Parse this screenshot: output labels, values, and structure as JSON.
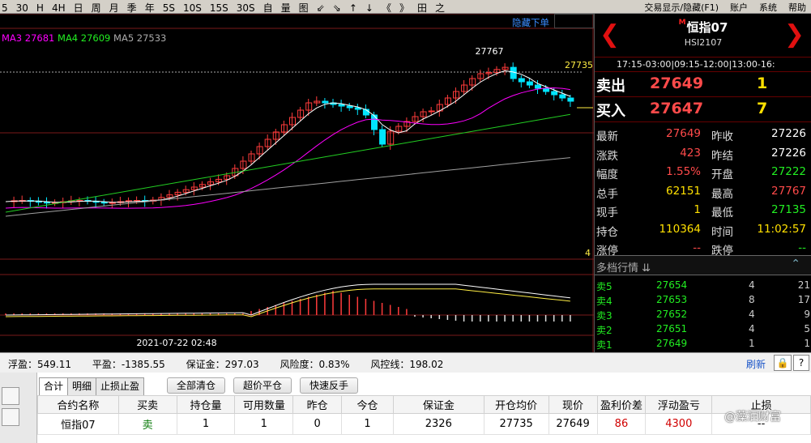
{
  "toolbar": {
    "items": [
      "5",
      "30",
      "H",
      "4H",
      "日",
      "周",
      "月",
      "季",
      "年",
      "5S",
      "10S",
      "15S",
      "30S",
      "自",
      "量",
      "图",
      "⇙",
      "⇘",
      "↑",
      "↓",
      "《",
      "》",
      "田",
      "之"
    ],
    "menu": [
      "交易显示/隐藏(F1)",
      "账户",
      "系统",
      "帮助"
    ]
  },
  "chart": {
    "ma_legend": {
      "ma3": "MA3 27681",
      "ma4": "MA4 27609",
      "ma5": "MA5 27533"
    },
    "hide_order_label": "隐藏下单",
    "high_label": "27767",
    "price_label": "27735",
    "lot_label": "4",
    "date_label": "2021-07-22 02:48",
    "colors": {
      "up": "#ff3b3b",
      "down": "#00e5ff",
      "ma3": "#ffffff",
      "ma4": "#ff00ff",
      "ma5_green": "#22cc22",
      "ma_gray": "#a0a0a0",
      "macd_white": "#ffffff",
      "macd_yellow": "#ffee44"
    }
  },
  "quote": {
    "name_prefix": "M",
    "name": "恒指07",
    "code": "HSI2107",
    "session": "17:15-03:00|09:15-12:00|13:00-16:",
    "ask": {
      "label": "卖出",
      "price": "27649",
      "volume": "1"
    },
    "bid": {
      "label": "买入",
      "price": "27647",
      "volume": "7"
    },
    "stats": [
      {
        "l1": "最新",
        "v1": "27649",
        "c1": "red",
        "l2": "昨收",
        "v2": "27226",
        "c2": "white"
      },
      {
        "l1": "涨跌",
        "v1": "423",
        "c1": "red",
        "l2": "昨结",
        "v2": "27226",
        "c2": "white"
      },
      {
        "l1": "幅度",
        "v1": "1.55%",
        "c1": "red",
        "l2": "开盘",
        "v2": "27222",
        "c2": "green"
      },
      {
        "l1": "总手",
        "v1": "62151",
        "c1": "yellow",
        "l2": "最高",
        "v2": "27767",
        "c2": "red"
      },
      {
        "l1": "现手",
        "v1": "1",
        "c1": "yellow",
        "l2": "最低",
        "v2": "27135",
        "c2": "green"
      },
      {
        "l1": "持仓",
        "v1": "110364",
        "c1": "yellow",
        "l2": "时间",
        "v2": "11:02:57",
        "c2": "yellow"
      },
      {
        "l1": "涨停",
        "v1": "--",
        "c1": "red",
        "l2": "跌停",
        "v2": "--",
        "c2": "green"
      }
    ],
    "depth_title": "多档行情",
    "depth": [
      {
        "label": "卖5",
        "price": "27654",
        "vol": "4",
        "total": "21"
      },
      {
        "label": "卖4",
        "price": "27653",
        "vol": "8",
        "total": "17"
      },
      {
        "label": "卖3",
        "price": "27652",
        "vol": "4",
        "total": "9"
      },
      {
        "label": "卖2",
        "price": "27651",
        "vol": "4",
        "total": "5"
      },
      {
        "label": "卖1",
        "price": "27649",
        "vol": "1",
        "total": "1"
      }
    ]
  },
  "account": {
    "float_pl": "浮盈：549.11",
    "close_pl": "平盈：-1385.55",
    "margin": "保证金：297.03",
    "risk": "风险度：0.83%",
    "risk_line": "风控线：198.02",
    "refresh": "刷新"
  },
  "trade": {
    "tabs": [
      "合计",
      "明细",
      "止损止盈"
    ],
    "actions": [
      "全部清仓",
      "超价平仓",
      "快速反手"
    ],
    "headers": [
      "合约名称",
      "买卖",
      "持仓量",
      "可用数量",
      "昨仓",
      "今仓",
      "保证金",
      "开仓均价",
      "现价",
      "盈利价差",
      "浮动盈亏",
      "止损"
    ],
    "rows": [
      [
        "恒指07",
        "卖",
        "1",
        "1",
        "0",
        "1",
        "2326",
        "27735",
        "27649",
        "86",
        "4300",
        "--"
      ]
    ],
    "watermark": "@藻洒财富"
  }
}
